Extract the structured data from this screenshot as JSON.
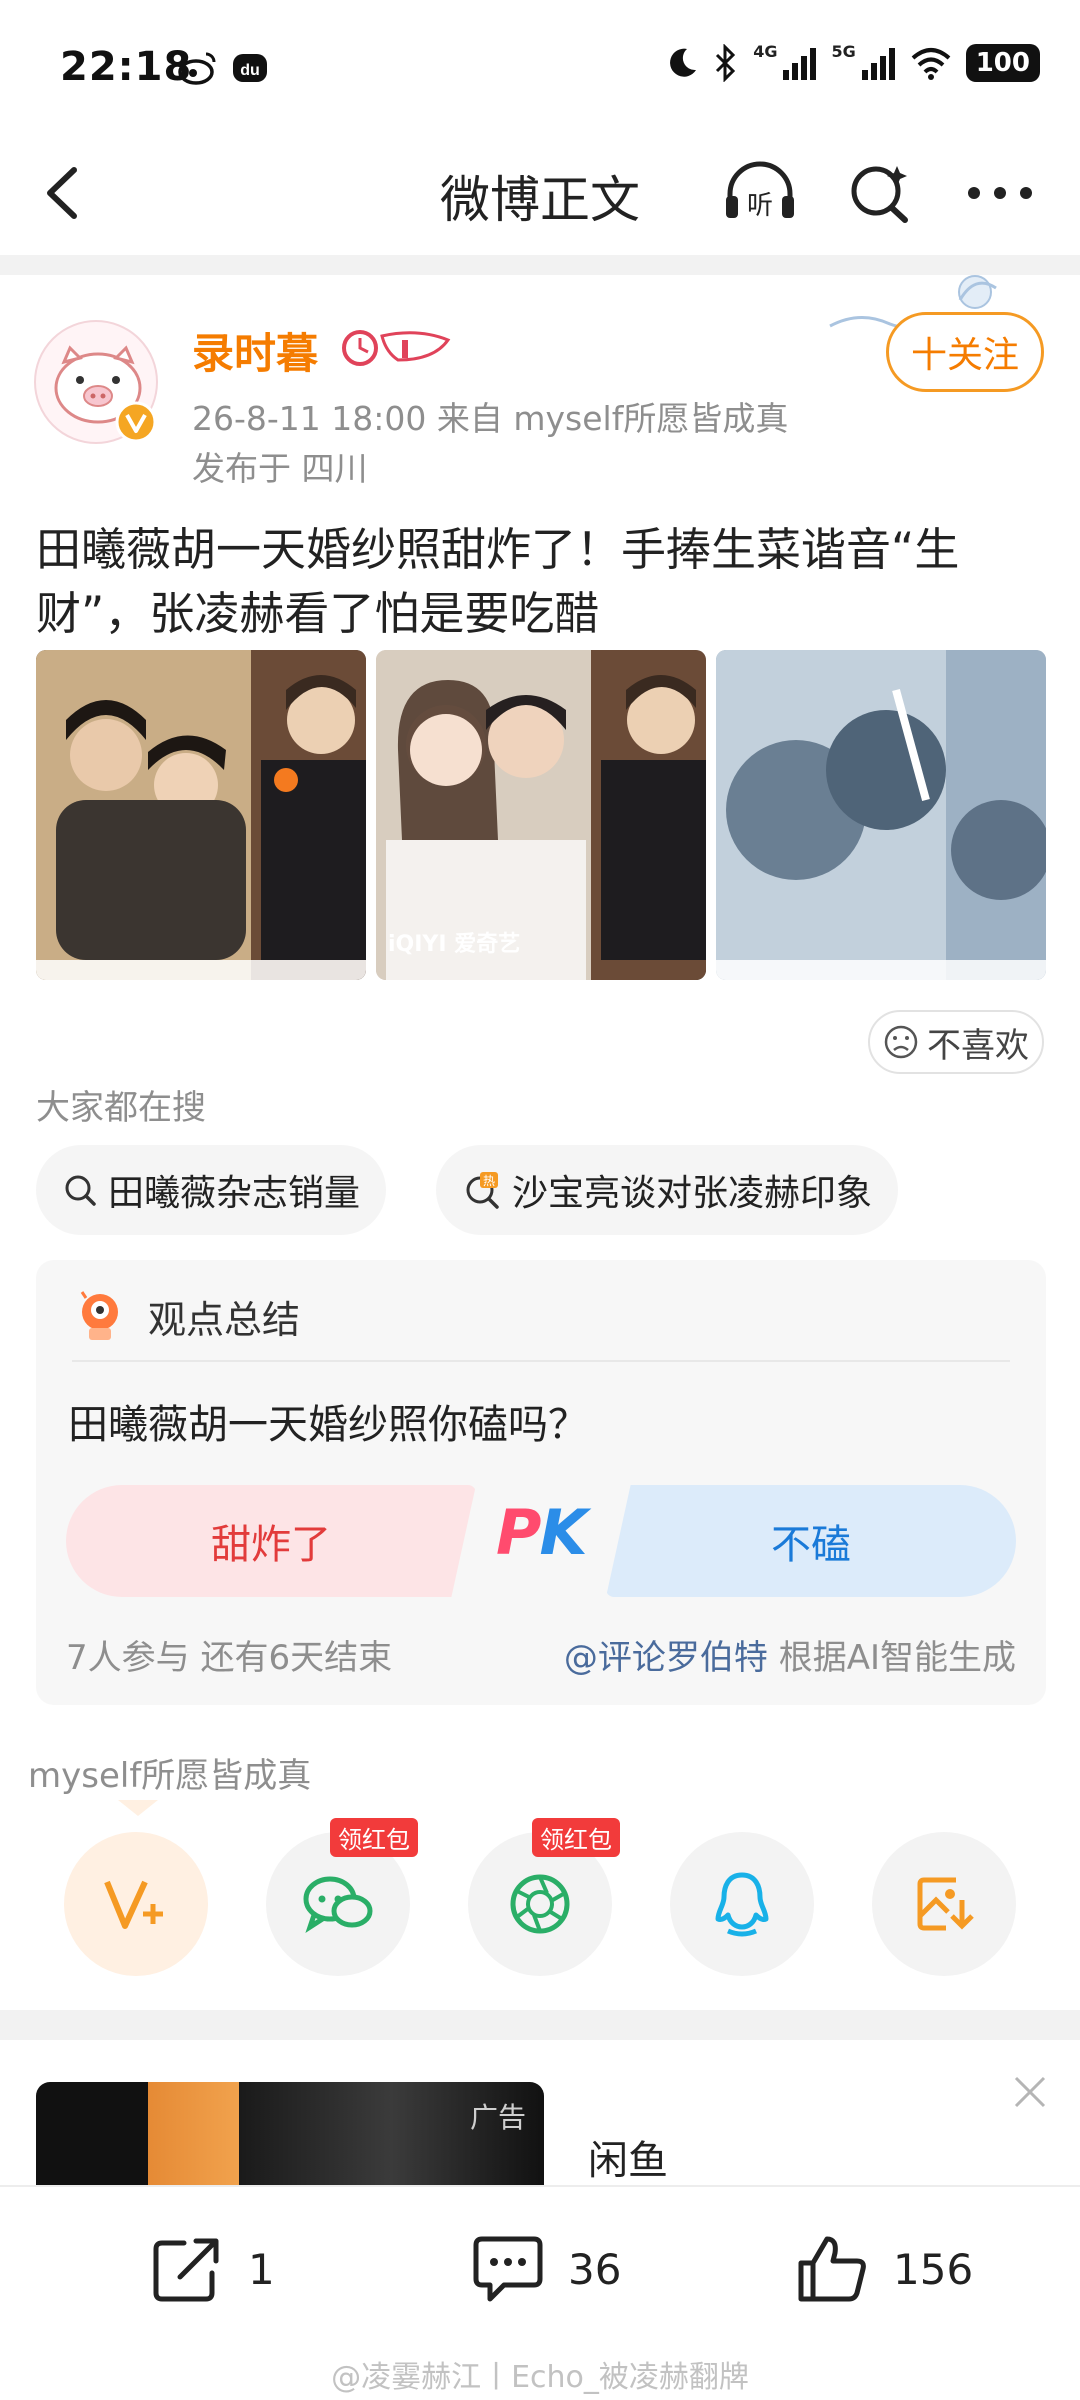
{
  "status_bar": {
    "time": "22:18",
    "network1": "4G",
    "network2": "5G",
    "battery": "100"
  },
  "nav": {
    "title": "微博正文",
    "listen_glyph": "听"
  },
  "post": {
    "username": "录时暮",
    "meta": "26-8-11 18:00   来自 myself所愿皆成真",
    "location": "发布于 四川",
    "follow_label": "十关注",
    "text": "田曦薇胡一天婚纱照甜炸了！手捧生菜谐音“生财”，张凌赫看了怕是要吃醋",
    "image2_watermark": "iQIYI 爱奇艺",
    "dislike_label": "不喜欢"
  },
  "searches": {
    "label": "大家都在搜",
    "chips": [
      "田曦薇杂志销量",
      "沙宝亮谈对张凌赫印象"
    ]
  },
  "poll": {
    "header": "观点总结",
    "question": "田曦薇胡一天婚纱照你磕吗？",
    "option_left": "甜炸了",
    "option_right": "不磕",
    "pk_p": "P",
    "pk_k": "K",
    "stats": "7人参与   还有6天结束",
    "credit_mention": "@评论罗伯特",
    "credit_suffix": " 根据AI智能生成"
  },
  "share": {
    "label": "myself所愿皆成真",
    "red_packet_tag": "领红包"
  },
  "ad": {
    "tag": "广告",
    "title": "闲鱼"
  },
  "actions": {
    "repost_count": "1",
    "comment_count": "36",
    "like_count": "156"
  },
  "watermark": "@凌霎赫江丨Echo_被凌赫翻牌",
  "colors": {
    "accent_orange": "#f57c00",
    "poll_red": "#e23b3b",
    "poll_blue": "#1a7ad8"
  }
}
